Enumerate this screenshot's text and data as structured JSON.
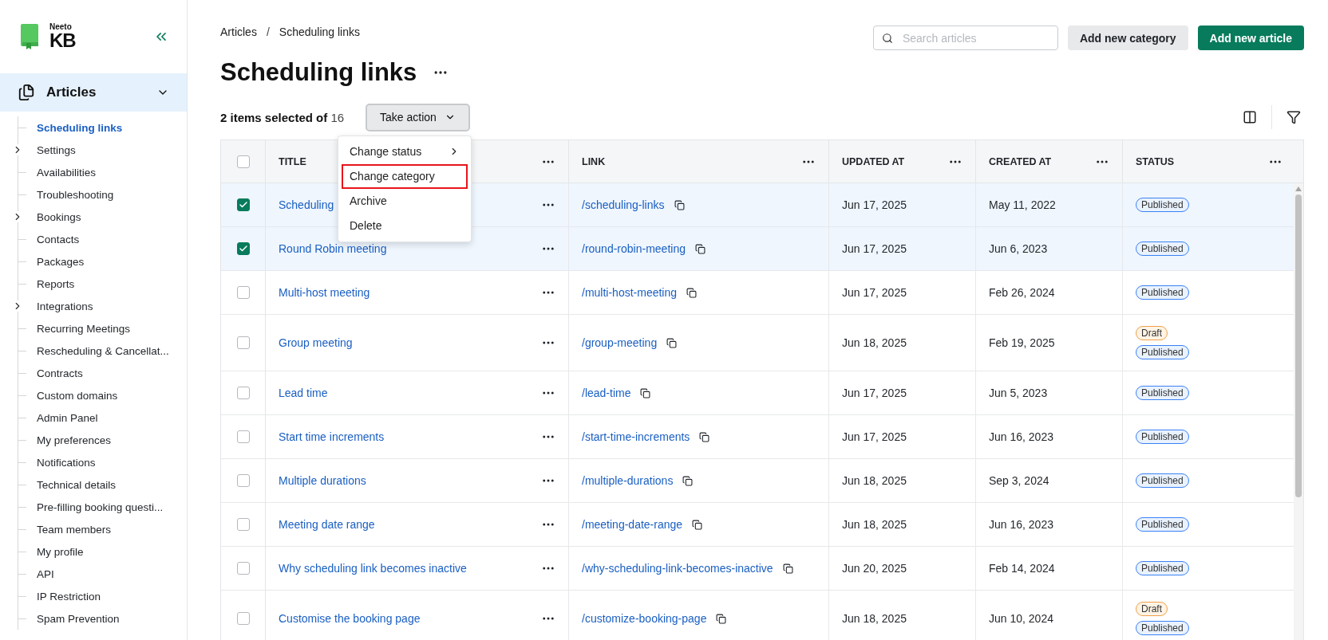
{
  "logo": {
    "top": "Neeto",
    "bottom": "KB"
  },
  "sidebar": {
    "section": {
      "label": "Articles",
      "expanded": true
    },
    "items": [
      {
        "label": "Scheduling links",
        "selected": true,
        "expandable": false
      },
      {
        "label": "Settings",
        "selected": false,
        "expandable": true
      },
      {
        "label": "Availabilities",
        "selected": false,
        "expandable": false
      },
      {
        "label": "Troubleshooting",
        "selected": false,
        "expandable": false
      },
      {
        "label": "Bookings",
        "selected": false,
        "expandable": true
      },
      {
        "label": "Contacts",
        "selected": false,
        "expandable": false
      },
      {
        "label": "Packages",
        "selected": false,
        "expandable": false
      },
      {
        "label": "Reports",
        "selected": false,
        "expandable": false
      },
      {
        "label": "Integrations",
        "selected": false,
        "expandable": true
      },
      {
        "label": "Recurring Meetings",
        "selected": false,
        "expandable": false
      },
      {
        "label": "Rescheduling & Cancellat...",
        "selected": false,
        "expandable": false
      },
      {
        "label": "Contracts",
        "selected": false,
        "expandable": false
      },
      {
        "label": "Custom domains",
        "selected": false,
        "expandable": false
      },
      {
        "label": "Admin Panel",
        "selected": false,
        "expandable": false
      },
      {
        "label": "My preferences",
        "selected": false,
        "expandable": false
      },
      {
        "label": "Notifications",
        "selected": false,
        "expandable": false
      },
      {
        "label": "Technical details",
        "selected": false,
        "expandable": false
      },
      {
        "label": "Pre-filling booking questi...",
        "selected": false,
        "expandable": false
      },
      {
        "label": "Team members",
        "selected": false,
        "expandable": false
      },
      {
        "label": "My profile",
        "selected": false,
        "expandable": false
      },
      {
        "label": "API",
        "selected": false,
        "expandable": false
      },
      {
        "label": "IP Restriction",
        "selected": false,
        "expandable": false
      },
      {
        "label": "Spam Prevention",
        "selected": false,
        "expandable": false
      }
    ]
  },
  "breadcrumb": [
    "Articles",
    "Scheduling links"
  ],
  "breadcrumb_separator": "/",
  "title": "Scheduling links",
  "search": {
    "placeholder": "Search articles"
  },
  "buttons": [
    {
      "label": "Add new category",
      "kind": "secondary"
    },
    {
      "label": "Add new article",
      "kind": "primary"
    }
  ],
  "selection": {
    "summary": "**2 items selected of** 16",
    "action": "Take action"
  },
  "action_menu": [
    {
      "label": "Change status",
      "submenu": true,
      "highlighted": false
    },
    {
      "label": "Change category",
      "submenu": false,
      "highlighted": true
    },
    {
      "label": "Archive",
      "submenu": false,
      "highlighted": false
    },
    {
      "label": "Delete",
      "submenu": false,
      "highlighted": false
    }
  ],
  "table": {
    "all_selected": false,
    "columns": [
      "TITLE",
      "LINK",
      "UPDATED AT",
      "CREATED AT",
      "STATUS"
    ],
    "rows": [
      {
        "selected": true,
        "title": "Scheduling",
        "link": "/scheduling-links",
        "updated": "Jun 17, 2025",
        "created": "May 11, 2022",
        "statuses": [
          {
            "label": "Published",
            "kind": "published"
          }
        ]
      },
      {
        "selected": true,
        "title": "Round Robin meeting",
        "link": "/round-robin-meeting",
        "updated": "Jun 17, 2025",
        "created": "Jun 6, 2023",
        "statuses": [
          {
            "label": "Published",
            "kind": "published"
          }
        ]
      },
      {
        "selected": false,
        "title": "Multi-host meeting",
        "link": "/multi-host-meeting",
        "updated": "Jun 17, 2025",
        "created": "Feb 26, 2024",
        "statuses": [
          {
            "label": "Published",
            "kind": "published"
          }
        ]
      },
      {
        "selected": false,
        "title": "Group meeting",
        "link": "/group-meeting",
        "updated": "Jun 18, 2025",
        "created": "Feb 19, 2025",
        "statuses": [
          {
            "label": "Draft",
            "kind": "draft"
          },
          {
            "label": "Published",
            "kind": "published"
          }
        ]
      },
      {
        "selected": false,
        "title": "Lead time",
        "link": "/lead-time",
        "updated": "Jun 17, 2025",
        "created": "Jun 5, 2023",
        "statuses": [
          {
            "label": "Published",
            "kind": "published"
          }
        ]
      },
      {
        "selected": false,
        "title": "Start time increments",
        "link": "/start-time-increments",
        "updated": "Jun 17, 2025",
        "created": "Jun 16, 2023",
        "statuses": [
          {
            "label": "Published",
            "kind": "published"
          }
        ]
      },
      {
        "selected": false,
        "title": "Multiple durations",
        "link": "/multiple-durations",
        "updated": "Jun 18, 2025",
        "created": "Sep 3, 2024",
        "statuses": [
          {
            "label": "Published",
            "kind": "published"
          }
        ]
      },
      {
        "selected": false,
        "title": "Meeting date range",
        "link": "/meeting-date-range",
        "updated": "Jun 18, 2025",
        "created": "Jun 16, 2023",
        "statuses": [
          {
            "label": "Published",
            "kind": "published"
          }
        ]
      },
      {
        "selected": false,
        "title": "Why scheduling link becomes inactive",
        "link": "/why-scheduling-link-becomes-inactive",
        "updated": "Jun 20, 2025",
        "created": "Feb 14, 2024",
        "statuses": [
          {
            "label": "Published",
            "kind": "published"
          }
        ]
      },
      {
        "selected": false,
        "title": "Customise the booking page",
        "link": "/customize-booking-page",
        "updated": "Jun 18, 2025",
        "created": "Jun 10, 2024",
        "statuses": [
          {
            "label": "Draft",
            "kind": "draft"
          },
          {
            "label": "Published",
            "kind": "published"
          }
        ]
      }
    ]
  }
}
